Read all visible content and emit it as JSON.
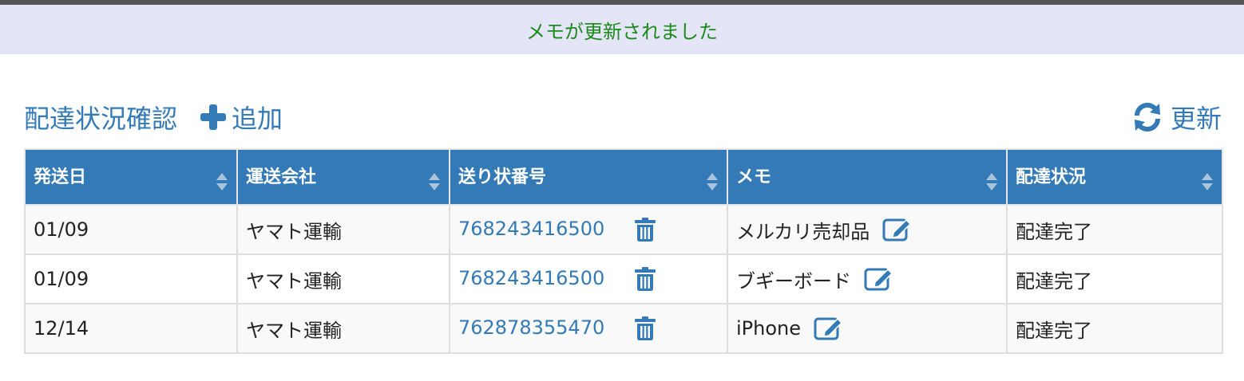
{
  "flash": {
    "message": "メモが更新されました"
  },
  "header": {
    "title": "配達状況確認",
    "add_label": "追加",
    "refresh_label": "更新"
  },
  "table": {
    "columns": [
      "発送日",
      "運送会社",
      "送り状番号",
      "メモ",
      "配達状況"
    ],
    "rows": [
      {
        "date": "01/09",
        "carrier": "ヤマト運輸",
        "tracking": "768243416500",
        "memo": "メルカリ売却品",
        "status": "配達完了"
      },
      {
        "date": "01/09",
        "carrier": "ヤマト運輸",
        "tracking": "768243416500",
        "memo": "ブギーボード",
        "status": "配達完了"
      },
      {
        "date": "12/14",
        "carrier": "ヤマト運輸",
        "tracking": "762878355470",
        "memo": "iPhone",
        "status": "配達完了"
      }
    ]
  },
  "colors": {
    "accent": "#337ab7",
    "flash_bg": "#e4e6f7",
    "flash_text": "#1b8a1b"
  },
  "icons": [
    "plus-icon",
    "refresh-icon",
    "sort-icon",
    "trash-icon",
    "edit-icon"
  ]
}
